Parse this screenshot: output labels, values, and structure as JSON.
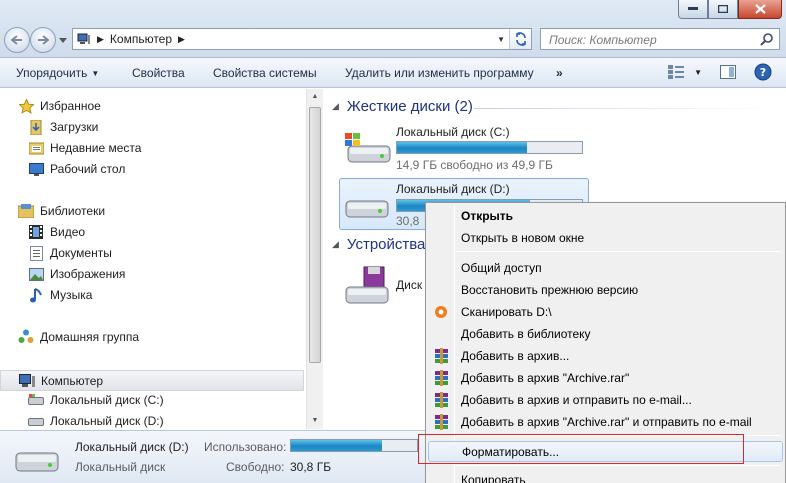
{
  "address": {
    "crumb": "Компьютер"
  },
  "search": {
    "placeholder": "Поиск: Компьютер"
  },
  "toolbar": {
    "organize": "Упорядочить",
    "properties": "Свойства",
    "system_properties": "Свойства системы",
    "uninstall": "Удалить или изменить программу",
    "more": "»"
  },
  "sidebar": {
    "favorites": "Избранное",
    "downloads": "Загрузки",
    "recent": "Недавние места",
    "desktop": "Рабочий стол",
    "libraries": "Библиотеки",
    "video": "Видео",
    "documents": "Документы",
    "images": "Изображения",
    "music": "Музыка",
    "homegroup": "Домашняя группа",
    "computer": "Компьютер",
    "disk_c": "Локальный диск (C:)",
    "disk_d": "Локальный диск (D:)"
  },
  "content": {
    "hdd_group": "Жесткие диски (2)",
    "devices_group": "Устройства",
    "drive_c": {
      "name": "Локальный диск (C:)",
      "free": "14,9 ГБ свободно из 49,9 ГБ",
      "used_fraction": 0.7
    },
    "drive_d": {
      "name": "Локальный диск (D:)",
      "free": "30,8",
      "used_fraction": 0.72
    },
    "removable": {
      "name": "Диск"
    }
  },
  "details": {
    "name": "Локальный диск (D:)",
    "type": "Локальный диск",
    "used_label": "Использовано:",
    "free_label": "Свободно:",
    "free_value": "30,8 ГБ",
    "used_fraction": 0.72
  },
  "context_menu": {
    "open": "Открыть",
    "open_new": "Открыть в новом окне",
    "share": "Общий доступ",
    "restore": "Восстановить прежнюю версию",
    "scan": "Сканировать D:\\",
    "add_library": "Добавить в библиотеку",
    "add_archive": "Добавить в архив...",
    "add_archive_rar": "Добавить в архив \"Archive.rar\"",
    "add_archive_email": "Добавить в архив и отправить по e-mail...",
    "add_archive_rar_email": "Добавить в архив \"Archive.rar\" и отправить по e-mail",
    "format": "Форматировать...",
    "copy": "Копировать"
  },
  "colors": {
    "accent_blue": "#1e3287",
    "bar_fill": "#1a86c4",
    "highlight_box": "#d9252b"
  }
}
